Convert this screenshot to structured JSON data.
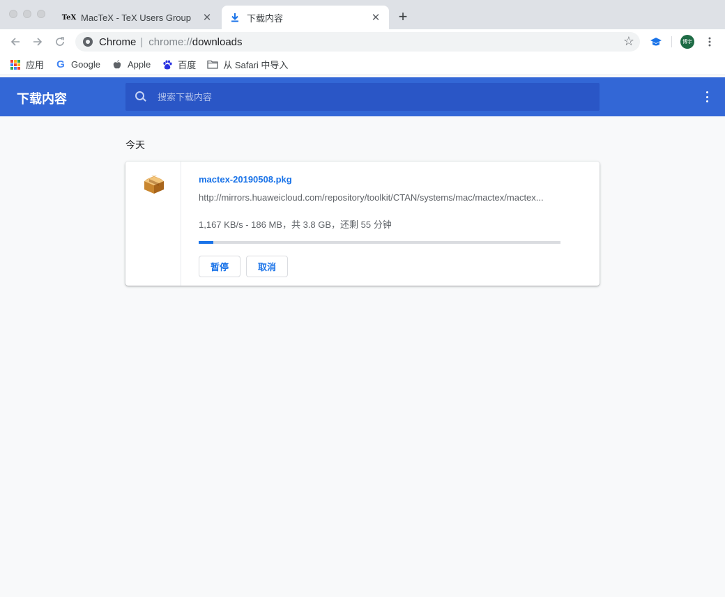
{
  "browser": {
    "tabs": [
      {
        "favicon_text": "TeX",
        "title": "MacTeX - TeX Users Group",
        "close": "✕"
      },
      {
        "title": "下载内容",
        "close": "✕",
        "active": true
      }
    ],
    "new_tab": "+",
    "omnibox": {
      "chip": "Chrome",
      "separator": "|",
      "scheme": "chrome://",
      "path": "downloads"
    },
    "avatar_text": "博宇",
    "bookmarks": [
      {
        "label": "应用",
        "icon": "apps-grid-icon"
      },
      {
        "label": "Google",
        "icon": "google-icon"
      },
      {
        "label": "Apple",
        "icon": "apple-icon"
      },
      {
        "label": "百度",
        "icon": "baidu-paw-icon"
      },
      {
        "label": "从 Safari 中导入",
        "icon": "folder-icon"
      }
    ]
  },
  "downloads": {
    "title": "下载内容",
    "search_placeholder": "搜索下载内容",
    "date_header": "今天",
    "item": {
      "file_name": "mactex-20190508.pkg",
      "url": "http://mirrors.huaweicloud.com/repository/toolkit/CTAN/systems/mac/mactex/mactex...",
      "status": "1,167 KB/s - 186 MB，共 3.8 GB，还剩 55 分钟",
      "progress_fraction": 0.04,
      "pause_label": "暂停",
      "cancel_label": "取消"
    }
  },
  "colors": {
    "header_blue": "#3367d6",
    "search_blue": "#2a56c6",
    "link_blue": "#1a73e8"
  }
}
